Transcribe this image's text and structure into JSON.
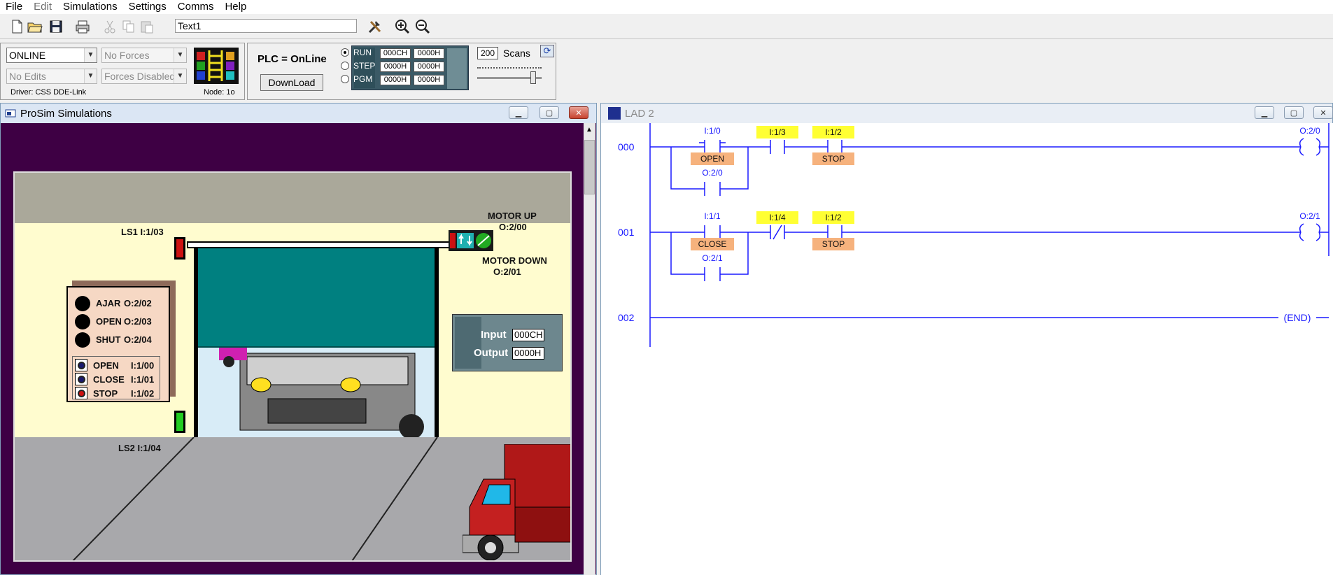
{
  "menu": [
    {
      "label": "File",
      "enabled": true
    },
    {
      "label": "Edit",
      "enabled": false
    },
    {
      "label": "Simulations",
      "enabled": true
    },
    {
      "label": "Settings",
      "enabled": true
    },
    {
      "label": "Comms",
      "enabled": true
    },
    {
      "label": "Help",
      "enabled": true
    }
  ],
  "toolbar": {
    "icons": [
      "new-file-icon",
      "open-folder-icon",
      "save-icon",
      "print-icon",
      "cut-icon",
      "copy-icon",
      "paste-icon",
      "tools-icon",
      "zoom-in-icon",
      "zoom-out-icon"
    ],
    "text_field_value": "Text1"
  },
  "control": {
    "mode_value": "ONLINE",
    "forces_value": "No Forces",
    "edits_value": "No Edits",
    "forces_enabled_value": "Forces Disabled",
    "driver_label": "Driver: CSS DDE-Link",
    "node_label": "Node: 1o"
  },
  "plc": {
    "status_label": "PLC = OnLine",
    "download_label": "DownLoad",
    "modes": [
      "RUN",
      "STEP",
      "PGM"
    ],
    "selected_mode": "RUN",
    "hex_values": [
      [
        "000CH",
        "0000H"
      ],
      [
        "0000H",
        "0000H"
      ],
      [
        "0000H",
        "0000H"
      ]
    ],
    "scans_value": "200",
    "scans_label": "Scans",
    "slider_level": 0.9
  },
  "sim_window": {
    "title": "ProSim Simulations",
    "labels": {
      "ls1": "LS1   I:1/03",
      "ls2": "LS2   I:1/04",
      "motor_up": "MOTOR UP",
      "motor_up_addr": "O:2/00",
      "motor_down": "MOTOR DOWN",
      "motor_down_addr": "O:2/01"
    },
    "lamps": [
      {
        "label": "AJAR",
        "addr": "O:2/02"
      },
      {
        "label": "OPEN",
        "addr": "O:2/03"
      },
      {
        "label": "SHUT",
        "addr": "O:2/04"
      }
    ],
    "buttons": [
      {
        "label": "OPEN",
        "addr": "I:1/00",
        "color": "#1a1a6e"
      },
      {
        "label": "CLOSE",
        "addr": "I:1/01",
        "color": "#1a1a6e"
      },
      {
        "label": "STOP",
        "addr": "I:1/02",
        "color": "#cc1111"
      }
    ],
    "io": {
      "input_label": "Input",
      "input_value": "000CH",
      "output_label": "Output",
      "output_value": "0000H"
    }
  },
  "lad_window": {
    "title": "LAD 2",
    "rungs": [
      {
        "number": "000",
        "contacts": [
          {
            "addr": "I:1/0",
            "tag": "OPEN",
            "tag_color": "orange",
            "highlight": false,
            "type": "NO"
          },
          {
            "addr": "I:1/3",
            "tag": "",
            "highlight": true,
            "type": "NO"
          },
          {
            "addr": "I:1/2",
            "tag": "STOP",
            "tag_color": "orange",
            "highlight": true,
            "type": "NO"
          }
        ],
        "branch": {
          "addr": "O:2/0"
        },
        "coil": {
          "addr": "O:2/0"
        }
      },
      {
        "number": "001",
        "contacts": [
          {
            "addr": "I:1/1",
            "tag": "CLOSE",
            "tag_color": "orange",
            "highlight": false,
            "type": "NO"
          },
          {
            "addr": "I:1/4",
            "tag": "",
            "highlight": true,
            "type": "NC"
          },
          {
            "addr": "I:1/2",
            "tag": "STOP",
            "tag_color": "orange",
            "highlight": true,
            "type": "NO"
          }
        ],
        "branch": {
          "addr": "O:2/1"
        },
        "coil": {
          "addr": "O:2/1"
        }
      },
      {
        "number": "002",
        "end_label": "END"
      }
    ]
  },
  "colors": {
    "ladder_blue": "#1a1aff",
    "sim_bg": "#3e0044",
    "door_teal": "#008080",
    "wall": "#fffccf",
    "floor": "#a8a8ab"
  }
}
